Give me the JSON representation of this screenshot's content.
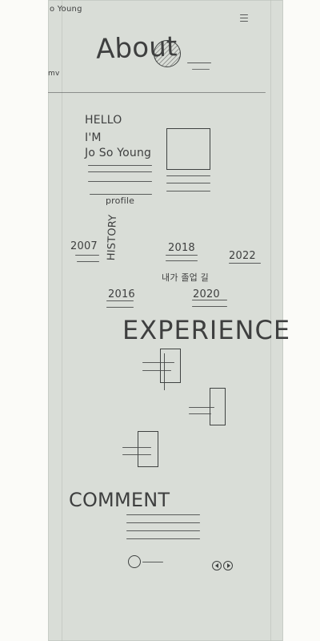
{
  "header": {
    "brand": "o Young",
    "nav_partial": "mv",
    "menu_icon": "hamburger-icon",
    "page_title": "About"
  },
  "intro": {
    "line1": "HELLO",
    "line2": "I'M",
    "line3": "Jo So Young",
    "profile_label": "profile"
  },
  "history": {
    "label": "HISTORY",
    "items": [
      {
        "year": "2007"
      },
      {
        "year": "2016"
      },
      {
        "year": "2018",
        "note": "내가 졸업 길"
      },
      {
        "year": "2020"
      },
      {
        "year": "2022"
      }
    ]
  },
  "experience": {
    "label": "EXPERIENCE"
  },
  "comment": {
    "label": "COMMENT"
  },
  "footer": {
    "icons": [
      "user-icon",
      "prev-icon",
      "next-icon"
    ]
  }
}
